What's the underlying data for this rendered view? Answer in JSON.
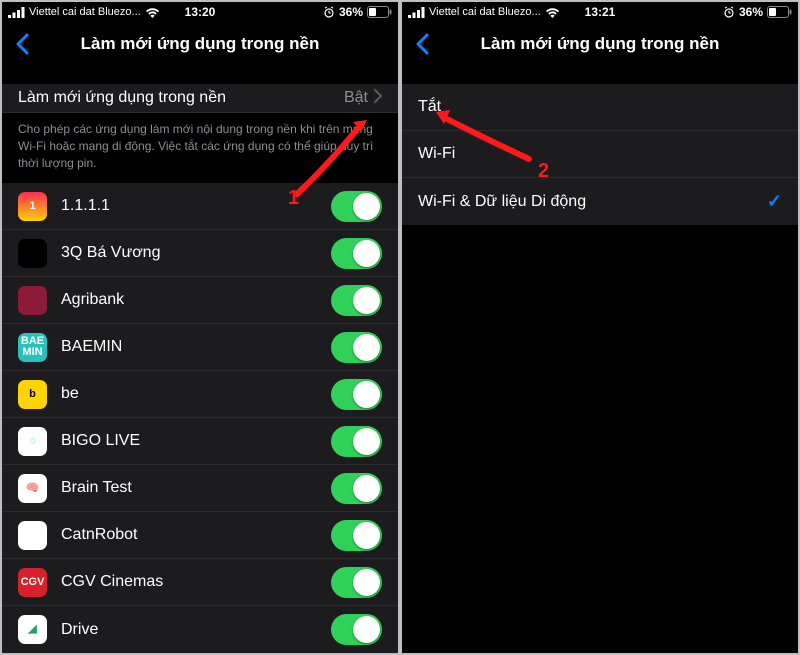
{
  "left": {
    "status": {
      "carrier": "Viettel cai dat Bluezo...",
      "time": "13:20",
      "battery_pct": "36%"
    },
    "nav_title": "Làm mới ứng dụng trong nền",
    "master": {
      "label": "Làm mới ứng dụng trong nền",
      "value": "Bật"
    },
    "footer": "Cho phép các ứng dụng làm mới nội dung trong nền khi trên mạng Wi-Fi hoặc mạng di động. Việc tắt các ứng dụng có thể giúp duy trì thời lượng pin.",
    "apps": [
      {
        "name": "1.1.1.1",
        "icon_bg": "linear-gradient(180deg,#ff2d55,#ffd200)",
        "icon_text": "1",
        "icon_color": "#fff"
      },
      {
        "name": "3Q Bá Vương",
        "icon_bg": "#000",
        "icon_text": "",
        "icon_color": "#fff"
      },
      {
        "name": "Agribank",
        "icon_bg": "#8c1b3a",
        "icon_text": "",
        "icon_color": "#fff"
      },
      {
        "name": "BAEMIN",
        "icon_bg": "#2ac1bc",
        "icon_text": "BAE\nMIN",
        "icon_color": "#fff"
      },
      {
        "name": "be",
        "icon_bg": "#ffd400",
        "icon_text": "b",
        "icon_color": "#000"
      },
      {
        "name": "BIGO LIVE",
        "icon_bg": "#ffffff",
        "icon_text": "◌",
        "icon_color": "#00c2d1"
      },
      {
        "name": "Brain Test",
        "icon_bg": "#ffffff",
        "icon_text": "🧠",
        "icon_color": "#e06565"
      },
      {
        "name": "CatnRobot",
        "icon_bg": "#ffffff",
        "icon_text": "",
        "icon_color": "#444"
      },
      {
        "name": "CGV Cinemas",
        "icon_bg": "#d6202b",
        "icon_text": "CGV",
        "icon_color": "#fff"
      },
      {
        "name": "Drive",
        "icon_bg": "#ffffff",
        "icon_text": "◢",
        "icon_color": "#1fa463"
      }
    ],
    "annotation_number": "1"
  },
  "right": {
    "status": {
      "carrier": "Viettel cai dat Bluezo...",
      "time": "13:21",
      "battery_pct": "36%"
    },
    "nav_title": "Làm mới ứng dụng trong nền",
    "options": [
      {
        "label": "Tắt",
        "checked": false
      },
      {
        "label": "Wi-Fi",
        "checked": false
      },
      {
        "label": "Wi-Fi & Dữ liệu Di động",
        "checked": true
      }
    ],
    "annotation_number": "2"
  }
}
